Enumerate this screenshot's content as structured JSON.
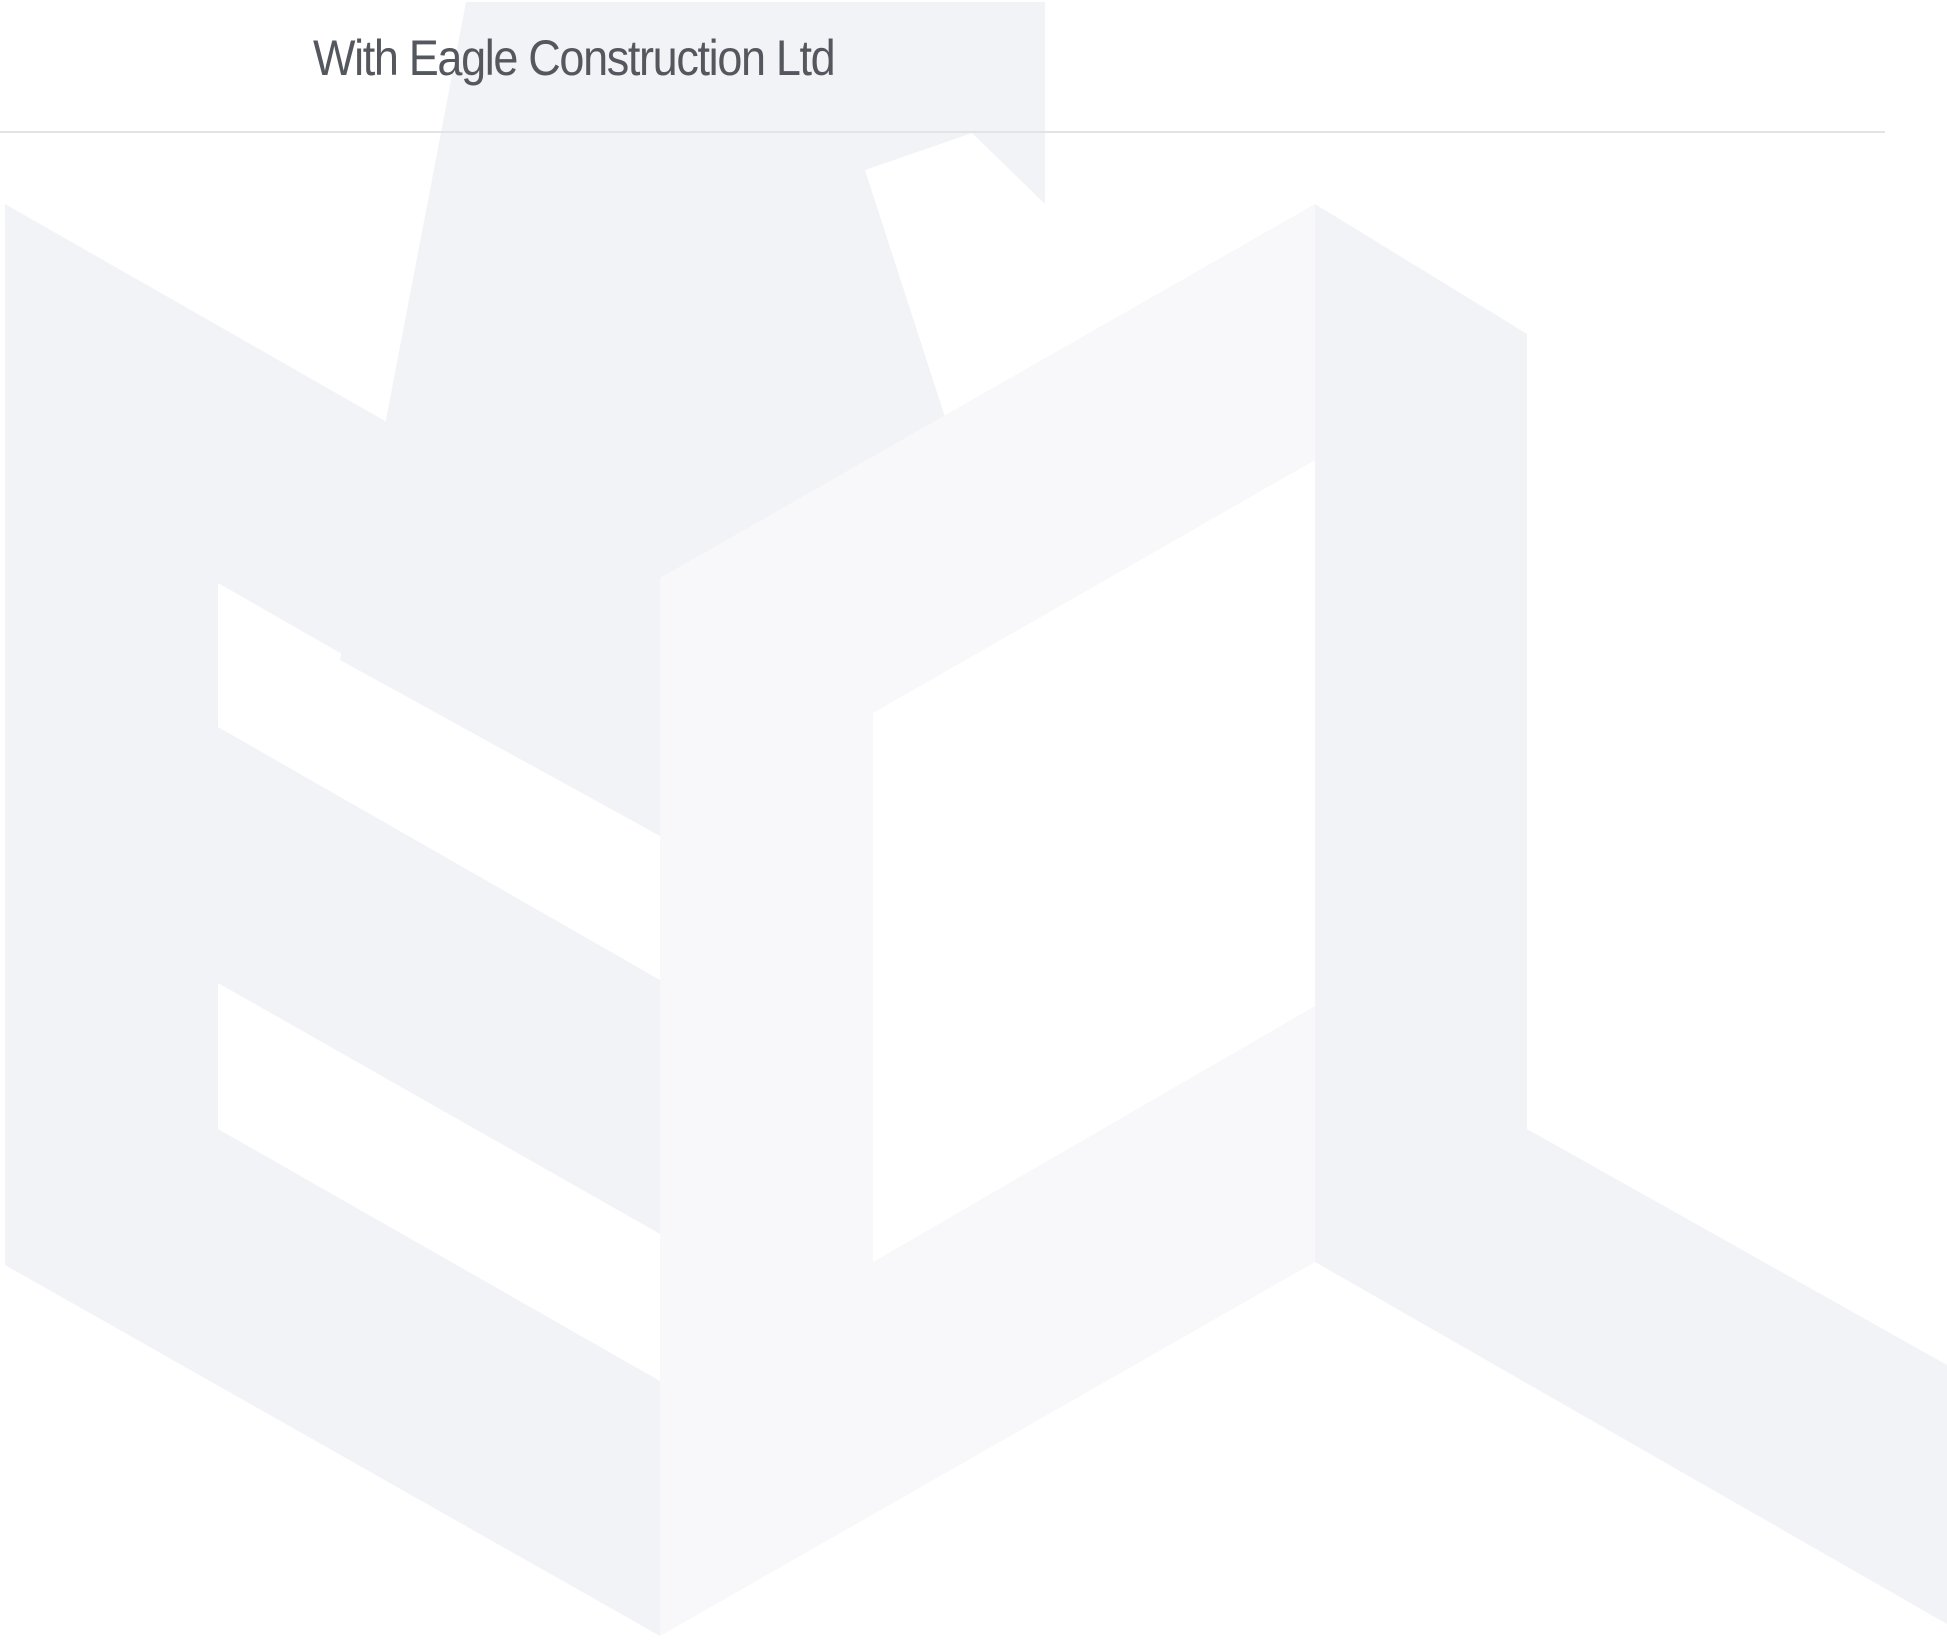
{
  "header": {
    "title": "With Eagle Construction Ltd"
  },
  "watermark": {
    "icon": "eagle-construction-logo",
    "letters": "ECL"
  },
  "colors": {
    "text": "#54575e",
    "divider": "#e3e4e8",
    "watermark_dark": "#f2f3f7",
    "watermark_light": "#f8f8fa",
    "background": "#ffffff"
  }
}
